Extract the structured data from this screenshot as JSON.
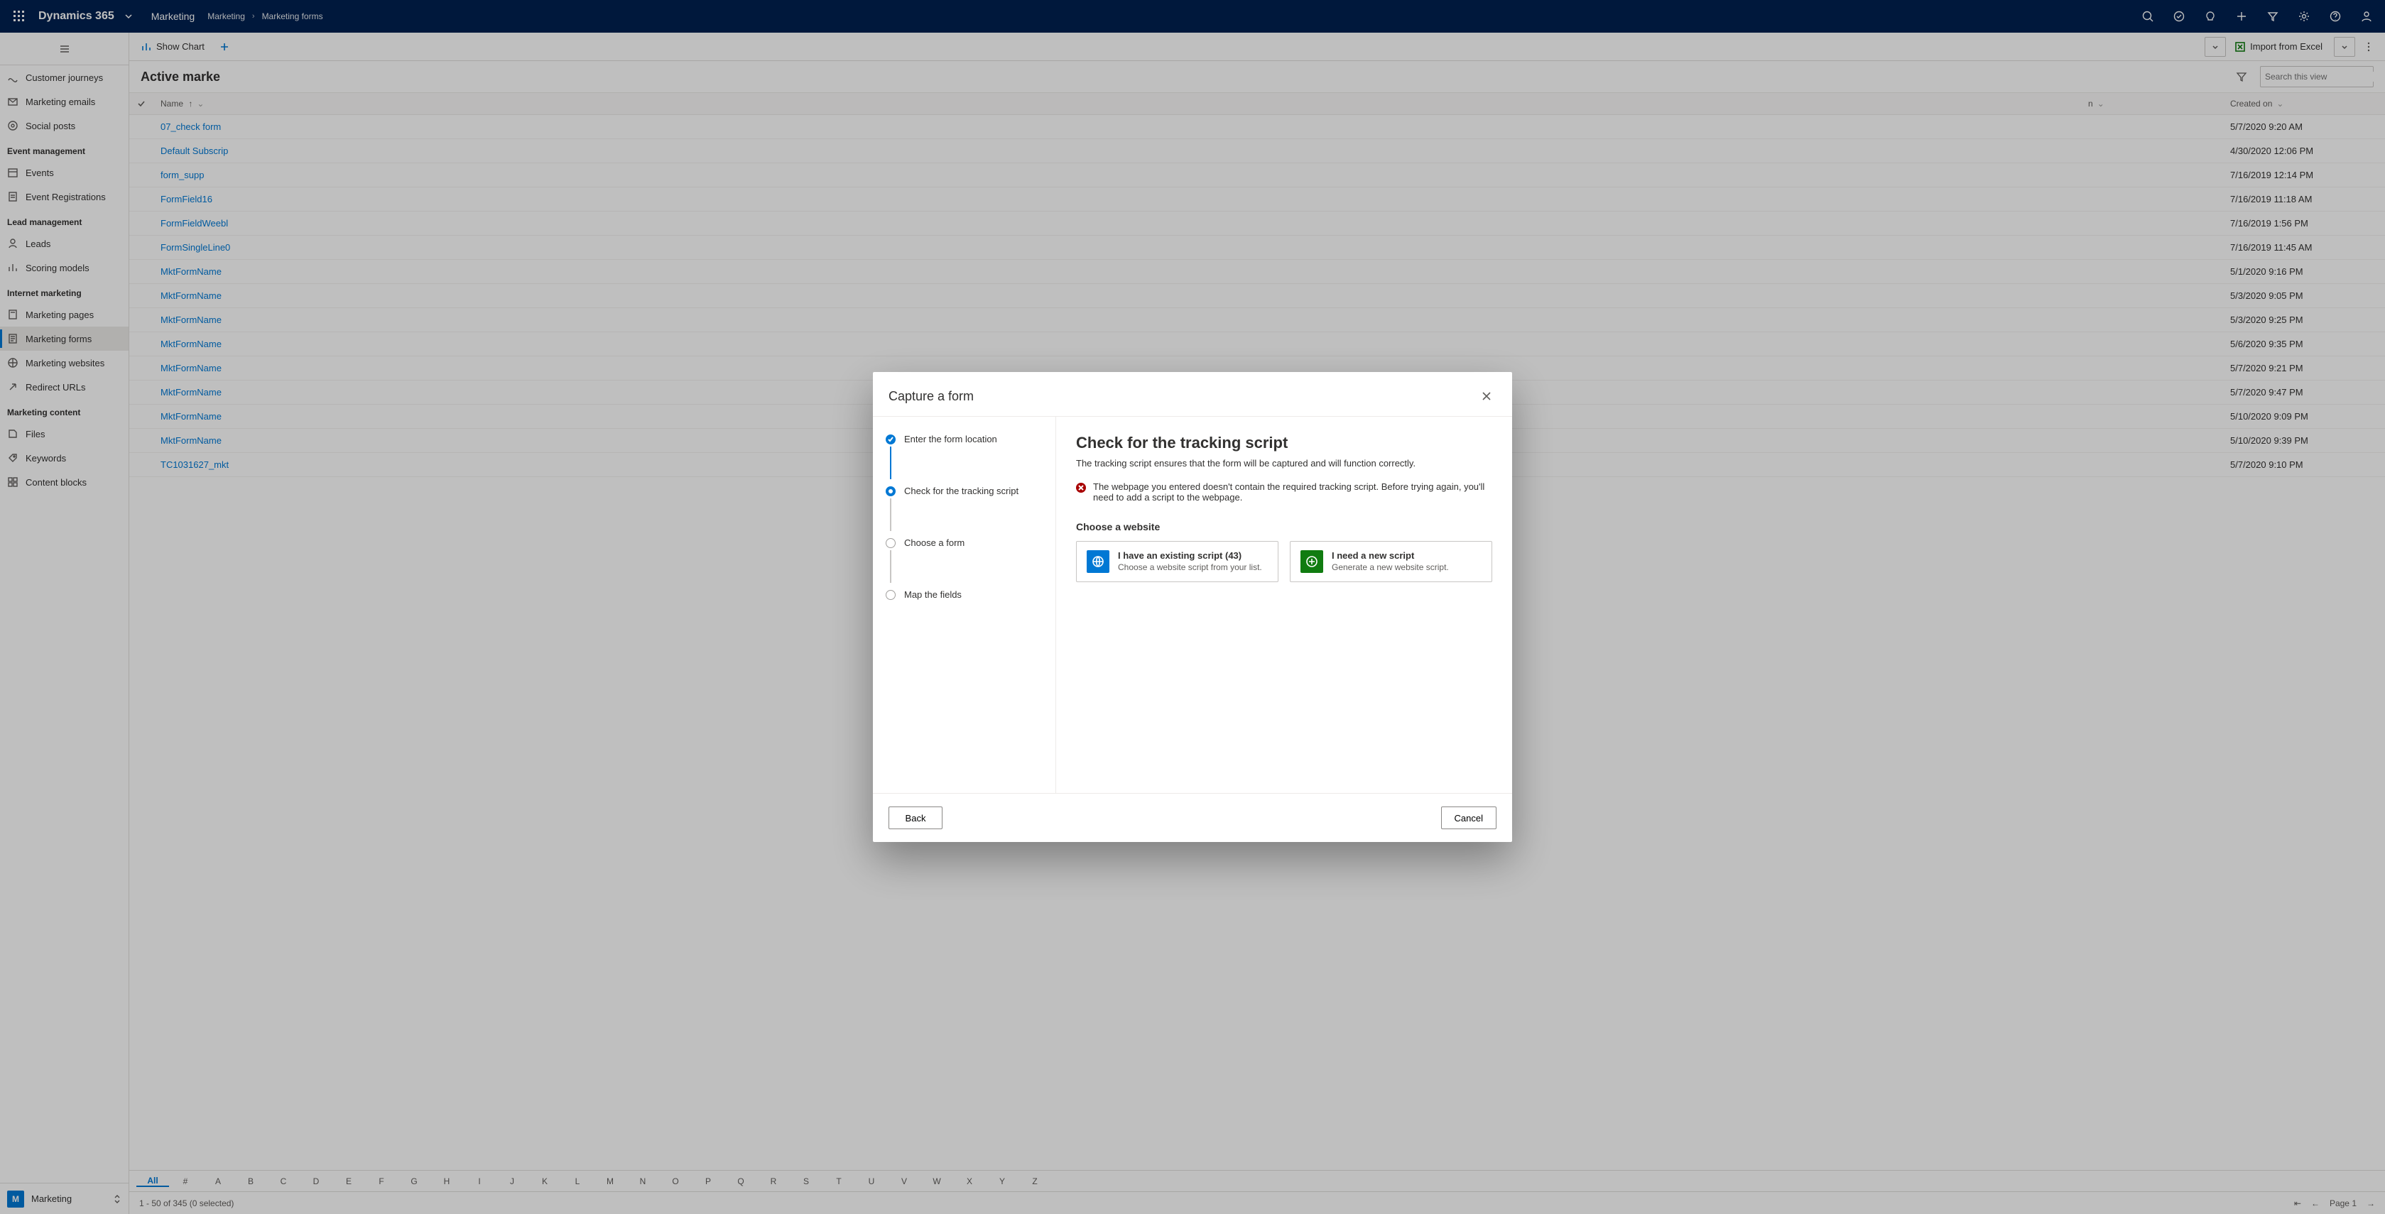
{
  "header": {
    "brand": "Dynamics 365",
    "module": "Marketing",
    "crumb1": "Marketing",
    "crumb2": "Marketing forms"
  },
  "cmdbar": {
    "show_chart": "Show Chart",
    "import_excel": "Import from Excel"
  },
  "view": {
    "title": "Active marke",
    "search_placeholder": "Search this view"
  },
  "columns": {
    "name": "Name",
    "modified": "n",
    "created": "Created on"
  },
  "sidebar": {
    "groups": [
      {
        "title": "",
        "items": [
          {
            "label": "Customer journeys",
            "active": false
          },
          {
            "label": "Marketing emails",
            "active": false
          },
          {
            "label": "Social posts",
            "active": false
          }
        ]
      },
      {
        "title": "Event management",
        "items": [
          {
            "label": "Events",
            "active": false
          },
          {
            "label": "Event Registrations",
            "active": false
          }
        ]
      },
      {
        "title": "Lead management",
        "items": [
          {
            "label": "Leads",
            "active": false
          },
          {
            "label": "Scoring models",
            "active": false
          }
        ]
      },
      {
        "title": "Internet marketing",
        "items": [
          {
            "label": "Marketing pages",
            "active": false
          },
          {
            "label": "Marketing forms",
            "active": true
          },
          {
            "label": "Marketing websites",
            "active": false
          },
          {
            "label": "Redirect URLs",
            "active": false
          }
        ]
      },
      {
        "title": "Marketing content",
        "items": [
          {
            "label": "Files",
            "active": false
          },
          {
            "label": "Keywords",
            "active": false
          },
          {
            "label": "Content blocks",
            "active": false
          }
        ]
      }
    ],
    "app_label": "Marketing",
    "app_initial": "M"
  },
  "rows": [
    {
      "name": "07_check form",
      "created": "5/7/2020 9:20 AM"
    },
    {
      "name": "Default Subscrip",
      "created": "4/30/2020 12:06 PM"
    },
    {
      "name": "form_supp",
      "created": "7/16/2019 12:14 PM"
    },
    {
      "name": "FormField16",
      "created": "7/16/2019 11:18 AM"
    },
    {
      "name": "FormFieldWeebl",
      "created": "7/16/2019 1:56 PM"
    },
    {
      "name": "FormSingleLine0",
      "created": "7/16/2019 11:45 AM"
    },
    {
      "name": "MktFormName",
      "created": "5/1/2020 9:16 PM"
    },
    {
      "name": "MktFormName",
      "created": "5/3/2020 9:05 PM"
    },
    {
      "name": "MktFormName",
      "created": "5/3/2020 9:25 PM"
    },
    {
      "name": "MktFormName",
      "created": "5/6/2020 9:35 PM"
    },
    {
      "name": "MktFormName",
      "created": "5/7/2020 9:21 PM"
    },
    {
      "name": "MktFormName",
      "created": "5/7/2020 9:47 PM"
    },
    {
      "name": "MktFormName",
      "created": "5/10/2020 9:09 PM"
    },
    {
      "name": "MktFormName",
      "created": "5/10/2020 9:39 PM"
    },
    {
      "name": "TC1031627_mkt",
      "created": "5/7/2020 9:10 PM"
    }
  ],
  "alphabar": [
    "All",
    "#",
    "A",
    "B",
    "C",
    "D",
    "E",
    "F",
    "G",
    "H",
    "I",
    "J",
    "K",
    "L",
    "M",
    "N",
    "O",
    "P",
    "Q",
    "R",
    "S",
    "T",
    "U",
    "V",
    "W",
    "X",
    "Y",
    "Z"
  ],
  "status": {
    "range": "1 - 50 of 345 (0 selected)",
    "page": "Page 1"
  },
  "dialog": {
    "title": "Capture a form",
    "steps": [
      "Enter the form location",
      "Check for the tracking script",
      "Choose a form",
      "Map the fields"
    ],
    "heading": "Check for the tracking script",
    "subtitle": "The tracking script ensures that the form will be captured and will function correctly.",
    "error": "The webpage you entered doesn't contain the required tracking script. Before trying again, you'll need to add a script to the webpage.",
    "choose_label": "Choose a website",
    "card1_title": "I have an existing script (43)",
    "card1_sub": "Choose a website script from your list.",
    "card2_title": "I need a new script",
    "card2_sub": "Generate a new website script.",
    "back": "Back",
    "cancel": "Cancel"
  }
}
